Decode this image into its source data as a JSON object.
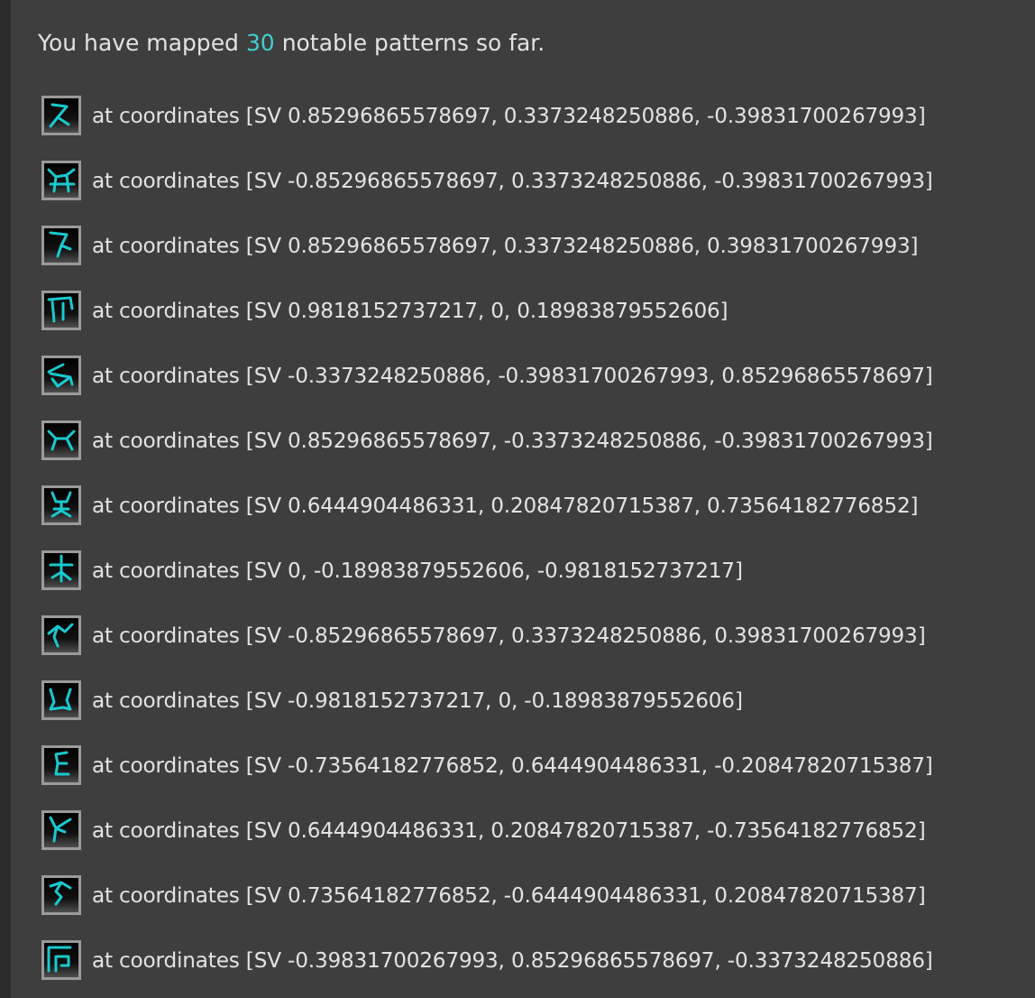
{
  "summary": {
    "prefix": "You have mapped ",
    "count": "30",
    "suffix": " notable patterns so far."
  },
  "patterns": [
    {
      "text": "at coordinates [SV 0.85296865578697, 0.3373248250886, -0.39831700267993]"
    },
    {
      "text": "at coordinates [SV -0.85296865578697, 0.3373248250886, -0.39831700267993]"
    },
    {
      "text": "at coordinates [SV 0.85296865578697, 0.3373248250886, 0.39831700267993]"
    },
    {
      "text": "at coordinates [SV 0.9818152737217, 0, 0.18983879552606]"
    },
    {
      "text": "at coordinates [SV -0.3373248250886, -0.39831700267993, 0.85296865578697]"
    },
    {
      "text": "at coordinates [SV 0.85296865578697, -0.3373248250886, -0.39831700267993]"
    },
    {
      "text": "at coordinates [SV 0.6444904486331, 0.20847820715387, 0.73564182776852]"
    },
    {
      "text": "at coordinates [SV 0, -0.18983879552606, -0.9818152737217]"
    },
    {
      "text": "at coordinates [SV -0.85296865578697, 0.3373248250886, 0.39831700267993]"
    },
    {
      "text": "at coordinates [SV -0.9818152737217, 0, -0.18983879552606]"
    },
    {
      "text": "at coordinates [SV -0.73564182776852, 0.6444904486331, -0.20847820715387]"
    },
    {
      "text": "at coordinates [SV 0.6444904486331, 0.20847820715387, -0.73564182776852]"
    },
    {
      "text": "at coordinates [SV 0.73564182776852, -0.6444904486331, 0.20847820715387]"
    },
    {
      "text": "at coordinates [SV -0.39831700267993, 0.85296865578697, -0.3373248250886]"
    }
  ]
}
